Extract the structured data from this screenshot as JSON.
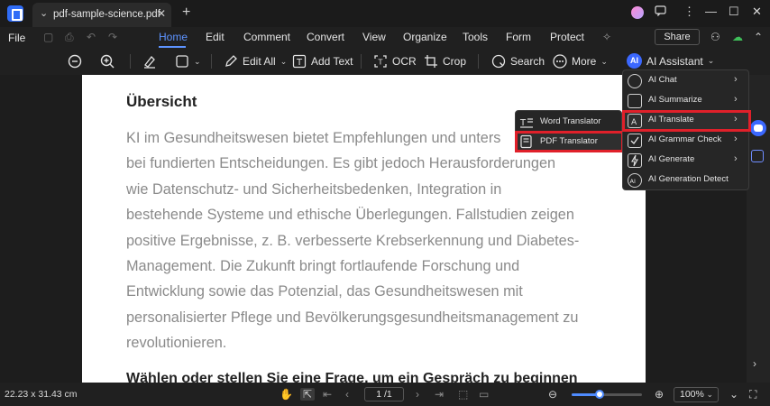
{
  "titlebar": {
    "tab_title": "pdf-sample-science.pdf",
    "tab_chevron": "⌄",
    "tab_close": "✕",
    "new_tab": "+",
    "minimize": "—",
    "maximize": "☐",
    "close": "✕"
  },
  "menubar": {
    "file": "File",
    "items": [
      "Home",
      "Edit",
      "Comment",
      "Convert",
      "View",
      "Organize",
      "Tools",
      "Form",
      "Protect"
    ],
    "active": "Home",
    "share": "Share"
  },
  "toolbar": {
    "edit_all": "Edit All",
    "add_text": "Add Text",
    "ocr": "OCR",
    "crop": "Crop",
    "search": "Search",
    "more": "More",
    "ai_assistant": "AI Assistant",
    "ai_badge": "AI"
  },
  "document": {
    "heading": "Übersicht",
    "lines": [
      "KI im Gesundheitswesen bietet Empfehlungen und unters",
      "bei fundierten Entscheidungen.   Es gibt jedoch Herausforderungen",
      "wie Datenschutz- und Sicherheitsbedenken, Integration in",
      "bestehende Systeme und ethische Überlegungen. Fallstudien zeigen",
      "positive Ergebnisse, z. B.   verbesserte Krebserkennung und Diabetes-",
      "Management. Die Zukunft bringt fortlaufende Forschung   und",
      "Entwicklung sowie das Potenzial, das Gesundheitswesen mit",
      "personalisierter Pflege und Bevölkerungsgesundheitsmanagement zu",
      "revolutionieren."
    ],
    "subheading": "Wählen oder stellen Sie eine Frage, um ein Gespräch zu beginnen"
  },
  "ai_menu": {
    "items": [
      {
        "label": "AI Chat",
        "icon": "chat-icon",
        "arrow": "›"
      },
      {
        "label": "AI Summarize",
        "icon": "summarize-icon",
        "arrow": "›"
      },
      {
        "label": "AI Translate",
        "icon": "translate-icon",
        "arrow": "›",
        "highlighted": true
      },
      {
        "label": "AI Grammar Check",
        "icon": "grammar-check-icon",
        "arrow": "›"
      },
      {
        "label": "AI Generate",
        "icon": "generate-icon",
        "arrow": "›"
      },
      {
        "label": "AI Generation Detect",
        "icon": "ai-detect-icon",
        "arrow": ""
      }
    ]
  },
  "translate_submenu": {
    "items": [
      {
        "label": "Word Translator",
        "icon": "word-translator-icon"
      },
      {
        "label": "PDF Translator",
        "icon": "pdf-translator-icon",
        "highlighted": true
      }
    ]
  },
  "statusbar": {
    "dimensions": "22.23 x 31.43 cm",
    "page": "1 /1",
    "zoom": "100%",
    "zoom_level_fraction": 0.4
  },
  "colors": {
    "accent": "#5d93ff",
    "highlight": "#e0202a",
    "ai_badge": "#3b68ff"
  }
}
